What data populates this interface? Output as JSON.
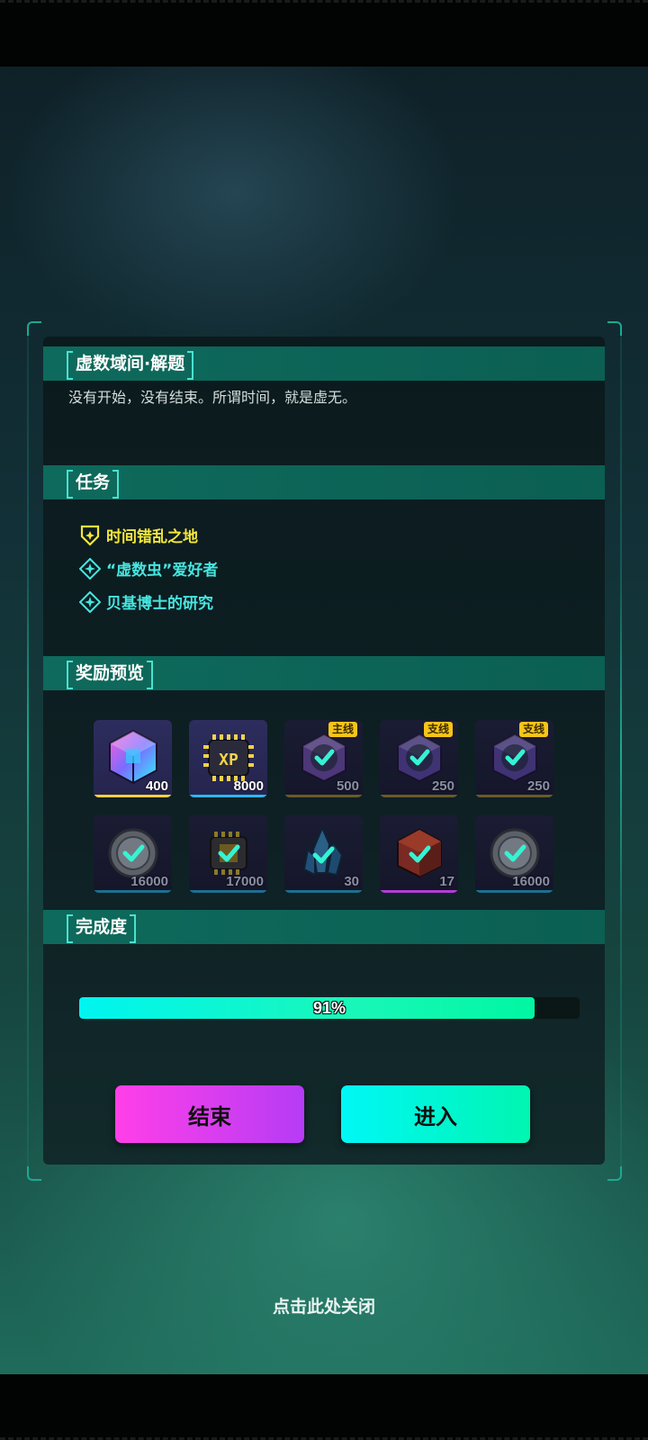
{
  "dialog": {
    "section_titles": {
      "description": "虚数域间·解题",
      "tasks": "任务",
      "rewards": "奖励预览",
      "completion": "完成度"
    },
    "description": "没有开始，没有结束。所谓时间，就是虚无。",
    "tasks": [
      {
        "label": "时间错乱之地",
        "kind": "main",
        "icon": "shield-plus-icon"
      },
      {
        "label": "“虚数虫”爱好者",
        "kind": "side",
        "icon": "diamond-plus-icon"
      },
      {
        "label": "贝基博士的研究",
        "kind": "side",
        "icon": "diamond-plus-icon"
      }
    ],
    "rewards_row1": [
      {
        "item": "holo-cube-icon",
        "amount": "400",
        "tag": "",
        "claimed": false,
        "line_color": "#f5d23a"
      },
      {
        "item": "xp-chip-icon",
        "amount": "8000",
        "tag": "",
        "claimed": false,
        "line_color": "#2bb8ff"
      },
      {
        "item": "holo-cube-icon",
        "amount": "500",
        "tag": "主线",
        "claimed": true,
        "line_color": "#6a5a2a"
      },
      {
        "item": "holo-cube-icon",
        "amount": "250",
        "tag": "支线",
        "claimed": true,
        "line_color": "#6a5a2a"
      },
      {
        "item": "holo-cube-icon",
        "amount": "250",
        "tag": "支线",
        "claimed": true,
        "line_color": "#6a5a2a"
      }
    ],
    "rewards_row2": [
      {
        "item": "coin-icon",
        "amount": "16000",
        "claimed": true,
        "line_color": "#1d6f8e"
      },
      {
        "item": "chip-icon",
        "amount": "17000",
        "claimed": true,
        "line_color": "#1d6f8e"
      },
      {
        "item": "crystal-icon",
        "amount": "30",
        "claimed": true,
        "line_color": "#1d6f8e"
      },
      {
        "item": "red-cube-icon",
        "amount": "17",
        "claimed": true,
        "line_color": "#b43cd8"
      },
      {
        "item": "coin-icon",
        "amount": "16000",
        "claimed": true,
        "line_color": "#1d6f8e"
      }
    ],
    "progress": {
      "value": 0.91,
      "label": "91%"
    },
    "buttons": {
      "end": "结束",
      "enter": "进入"
    }
  },
  "close_hint": "点击此处关闭",
  "colors": {
    "accent_teal": "#0e6a5c",
    "main_task": "#f3e63c",
    "side_task": "#46e6e0",
    "tag_yellow": "#f5c518"
  }
}
